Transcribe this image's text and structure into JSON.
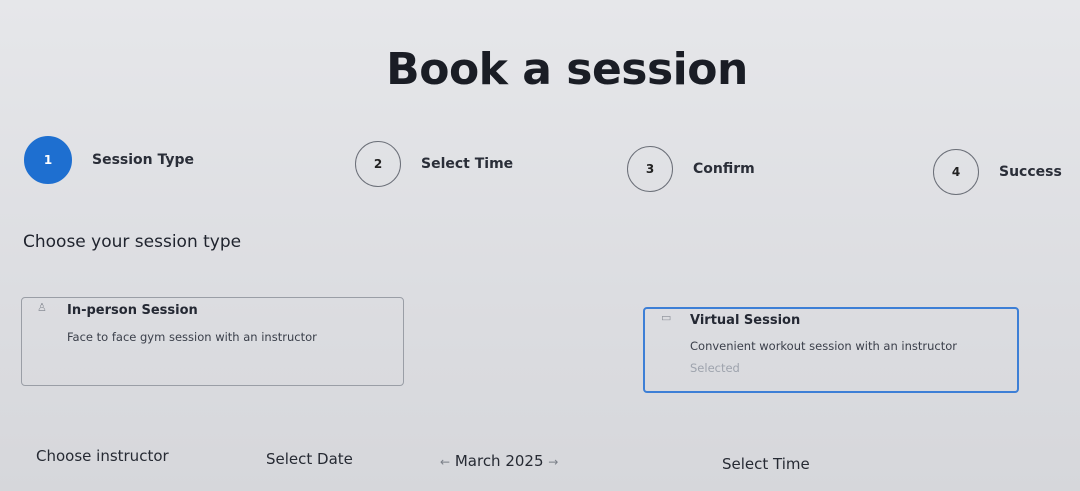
{
  "page_title": "Book a session",
  "steps": [
    {
      "number": "1",
      "label": "Session Type",
      "active": true
    },
    {
      "number": "2",
      "label": "Select Time",
      "active": false
    },
    {
      "number": "3",
      "label": "Confirm",
      "active": false
    },
    {
      "number": "4",
      "label": "Success",
      "active": false
    }
  ],
  "section_title": "Choose your session type",
  "options": [
    {
      "icon": "person-icon",
      "icon_glyph": "♙",
      "name": "In-person Session",
      "description": "Face to face gym session with an instructor",
      "status": ""
    },
    {
      "icon": "video-icon",
      "icon_glyph": "▭",
      "name": "Virtual Session",
      "description": "Convenient workout session with an instructor",
      "status": "Selected"
    }
  ],
  "footer": {
    "instructor_label": "Choose instructor",
    "date_label": "Select Date",
    "month_label": "March 2025",
    "prev_arrow": "←",
    "next_arrow": "→",
    "time_label": "Select Time"
  },
  "colors": {
    "accent": "#1e6fd0",
    "selected_border": "#3d7fd6"
  }
}
